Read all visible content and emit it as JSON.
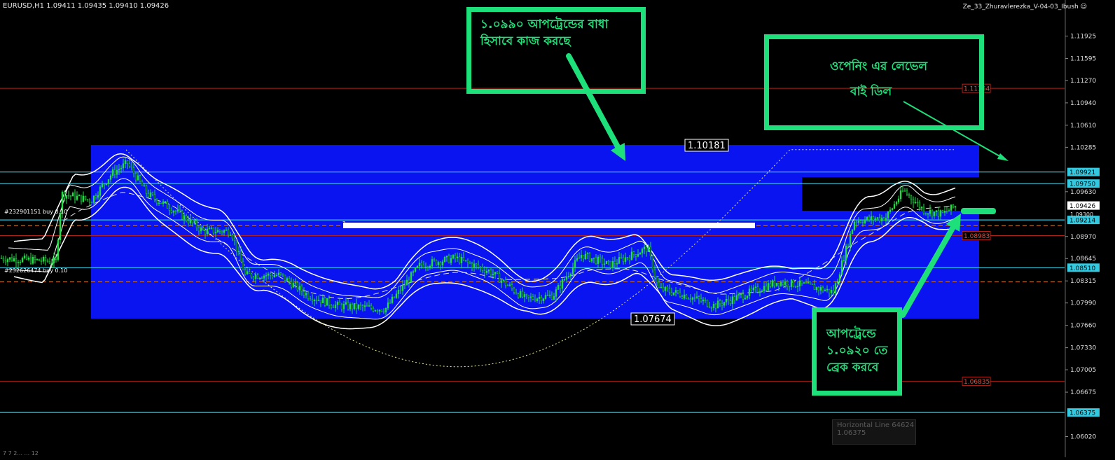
{
  "window": {
    "symbol_ohlc": "EURUSD,H1  1.09411 1.09435 1.09410 1.09426",
    "expert_name": "Ze_33_Zhuravlerezka_V-04-03_Ibush",
    "smiley": "☺"
  },
  "colors": {
    "background": "#000000",
    "zone_blue": "#0a14f0",
    "candle_green": "#22dd44",
    "band_white": "#ffffff",
    "cyan_level": "#33c9e0",
    "red_level": "#b0221a",
    "orange_dash": "#d97a2a",
    "annotation_green": "#1ee07a"
  },
  "price_axis": {
    "ticks": [
      "1.11925",
      "1.11595",
      "1.11270",
      "1.10940",
      "1.10610",
      "1.10285",
      "1.09630",
      "1.08970",
      "1.08645",
      "1.08315",
      "1.07990",
      "1.07660",
      "1.07330",
      "1.07005",
      "1.06675",
      "1.06020"
    ],
    "min": 1.0585,
    "max": 1.1225
  },
  "level_labels": {
    "cyan": [
      "1.09921",
      "1.09750",
      "1.09214",
      "1.08510",
      "1.06375"
    ],
    "red": [
      "1.11154",
      "1.08983",
      "1.06835"
    ],
    "current_price": "1.09426",
    "partial_price": "1.09300"
  },
  "chart_labels": {
    "zone_top": "1.10181",
    "zone_bottom": "1.07674",
    "order1": "#232901151 buy 0.10",
    "order2": "#232626474 buy 0.10",
    "sub_glyph": "?",
    "bottom_cut": "7 7 2... ... 12"
  },
  "annotations": {
    "box1": {
      "line1": "১.০৯৯০ আপট্রেন্ডের বাধা",
      "line2": "হিসাবে কাজ করছে"
    },
    "box2": {
      "line1": "ওপেনিং এর লেভেল",
      "line2": "বাই ডিল"
    },
    "box3": {
      "line1": "আপট্রেন্ডে",
      "line2": "১.০৯২০ তে",
      "line3": "ব্রেক করবে"
    }
  },
  "hover_tip": {
    "name": "Horizontal Line 64624",
    "price": "1.06375"
  }
}
